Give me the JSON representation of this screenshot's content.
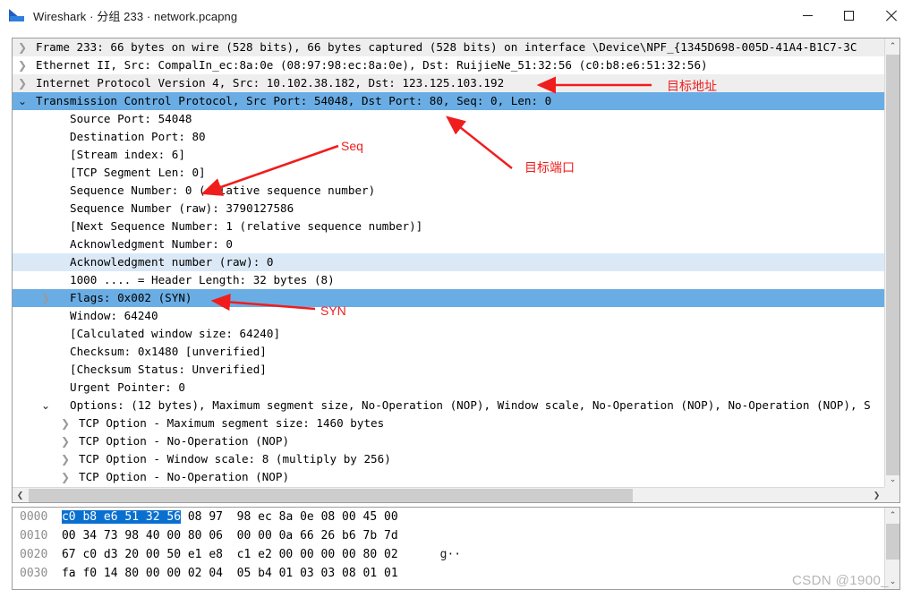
{
  "window": {
    "title": "Wireshark · 分组 233 · network.pcapng",
    "icon": "wireshark-fin-icon",
    "minimize_label": "—",
    "maximize_label": "□",
    "close_label": "✕"
  },
  "detail_tree": {
    "rows": [
      {
        "text": "Frame 233: 66 bytes on wire (528 bits), 66 bytes captured (528 bits) on interface \\Device\\NPF_{1345D698-005D-41A4-B1C7-3C",
        "twisty": "collapsed",
        "indent": 0,
        "state": "alt"
      },
      {
        "text": "Ethernet II, Src: CompalIn_ec:8a:0e (08:97:98:ec:8a:0e), Dst: RuijieNe_51:32:56 (c0:b8:e6:51:32:56)",
        "twisty": "collapsed",
        "indent": 0,
        "state": "normal"
      },
      {
        "text": "Internet Protocol Version 4, Src: 10.102.38.182, Dst: 123.125.103.192",
        "twisty": "collapsed",
        "indent": 0,
        "state": "alt"
      },
      {
        "text": "Transmission Control Protocol, Src Port: 54048, Dst Port: 80, Seq: 0, Len: 0",
        "twisty": "expanded",
        "indent": 0,
        "state": "selected"
      },
      {
        "text": "Source Port: 54048",
        "twisty": "none",
        "indent": 1,
        "state": "normal"
      },
      {
        "text": "Destination Port: 80",
        "twisty": "none",
        "indent": 1,
        "state": "normal"
      },
      {
        "text": "[Stream index: 6]",
        "twisty": "none",
        "indent": 1,
        "state": "normal"
      },
      {
        "text": "[TCP Segment Len: 0]",
        "twisty": "none",
        "indent": 1,
        "state": "normal"
      },
      {
        "text": "Sequence Number: 0    (relative sequence number)",
        "twisty": "none",
        "indent": 1,
        "state": "normal"
      },
      {
        "text": "Sequence Number (raw): 3790127586",
        "twisty": "none",
        "indent": 1,
        "state": "normal"
      },
      {
        "text": "[Next Sequence Number: 1    (relative sequence number)]",
        "twisty": "none",
        "indent": 1,
        "state": "normal"
      },
      {
        "text": "Acknowledgment Number: 0",
        "twisty": "none",
        "indent": 1,
        "state": "normal"
      },
      {
        "text": "Acknowledgment number (raw): 0",
        "twisty": "none",
        "indent": 1,
        "state": "light"
      },
      {
        "text": "1000 .... = Header Length: 32 bytes (8)",
        "twisty": "none",
        "indent": 1,
        "state": "normal"
      },
      {
        "text": "Flags: 0x002 (SYN)",
        "twisty": "collapsed",
        "indent": 1,
        "state": "selected"
      },
      {
        "text": "Window: 64240",
        "twisty": "none",
        "indent": 1,
        "state": "normal"
      },
      {
        "text": "[Calculated window size: 64240]",
        "twisty": "none",
        "indent": 1,
        "state": "normal"
      },
      {
        "text": "Checksum: 0x1480 [unverified]",
        "twisty": "none",
        "indent": 1,
        "state": "normal"
      },
      {
        "text": "[Checksum Status: Unverified]",
        "twisty": "none",
        "indent": 1,
        "state": "normal"
      },
      {
        "text": "Urgent Pointer: 0",
        "twisty": "none",
        "indent": 1,
        "state": "normal"
      },
      {
        "text": "Options: (12 bytes), Maximum segment size, No-Operation (NOP), Window scale, No-Operation (NOP), No-Operation (NOP), S",
        "twisty": "expanded",
        "indent": 1,
        "state": "normal"
      },
      {
        "text": "TCP Option - Maximum segment size: 1460 bytes",
        "twisty": "collapsed2",
        "indent": 2,
        "state": "normal"
      },
      {
        "text": "TCP Option - No-Operation (NOP)",
        "twisty": "collapsed2",
        "indent": 2,
        "state": "normal"
      },
      {
        "text": "TCP Option - Window scale: 8 (multiply by 256)",
        "twisty": "collapsed2",
        "indent": 2,
        "state": "normal"
      },
      {
        "text": "TCP Option - No-Operation (NOP)",
        "twisty": "collapsed2",
        "indent": 2,
        "state": "normal"
      }
    ],
    "twisty_collapsed": "❯",
    "twisty_expanded": "⌄",
    "scroll_up_arrow": "⌃",
    "scroll_down_arrow": "⌄",
    "scroll_left_arrow": "❮",
    "scroll_right_arrow": "❯"
  },
  "bytes_pane": {
    "rows": [
      {
        "offset": "0000",
        "sel_hex": "c0 b8 e6 51 32 56",
        "hex_a": " 08 97",
        "hex_b": "98 ec 8a 0e 08 00 45 00",
        "ascii": ""
      },
      {
        "offset": "0010",
        "sel_hex": "",
        "hex_a": "00 34 73 98 40 00 80 06",
        "hex_b": "00 00 0a 66 26 b6 7b 7d",
        "ascii": ""
      },
      {
        "offset": "0020",
        "sel_hex": "",
        "hex_a": "67 c0 d3 20 00 50 e1 e8",
        "hex_b": "c1 e2 00 00 00 00 80 02",
        "ascii": "g··"
      },
      {
        "offset": "0030",
        "sel_hex": "",
        "hex_a": "fa f0 14 80 00 00 02 04",
        "hex_b": "05 b4 01 03 03 08 01 01",
        "ascii": ""
      }
    ],
    "scroll_up_arrow": "⌃",
    "scroll_down_arrow": "⌄"
  },
  "annotations": [
    {
      "name": "target-address",
      "label": "目标地址"
    },
    {
      "name": "target-port",
      "label": "目标端口"
    },
    {
      "name": "seq",
      "label": "Seq"
    },
    {
      "name": "syn",
      "label": "SYN"
    }
  ],
  "watermark": {
    "text": "CSDN @1900_"
  },
  "colors": {
    "selection_blue": "#6aade4",
    "light_blue": "#dbe9f7",
    "hex_selection": "#0a70d0",
    "annotation_red": "#f01d1d",
    "alt_row": "#eeeeee"
  }
}
